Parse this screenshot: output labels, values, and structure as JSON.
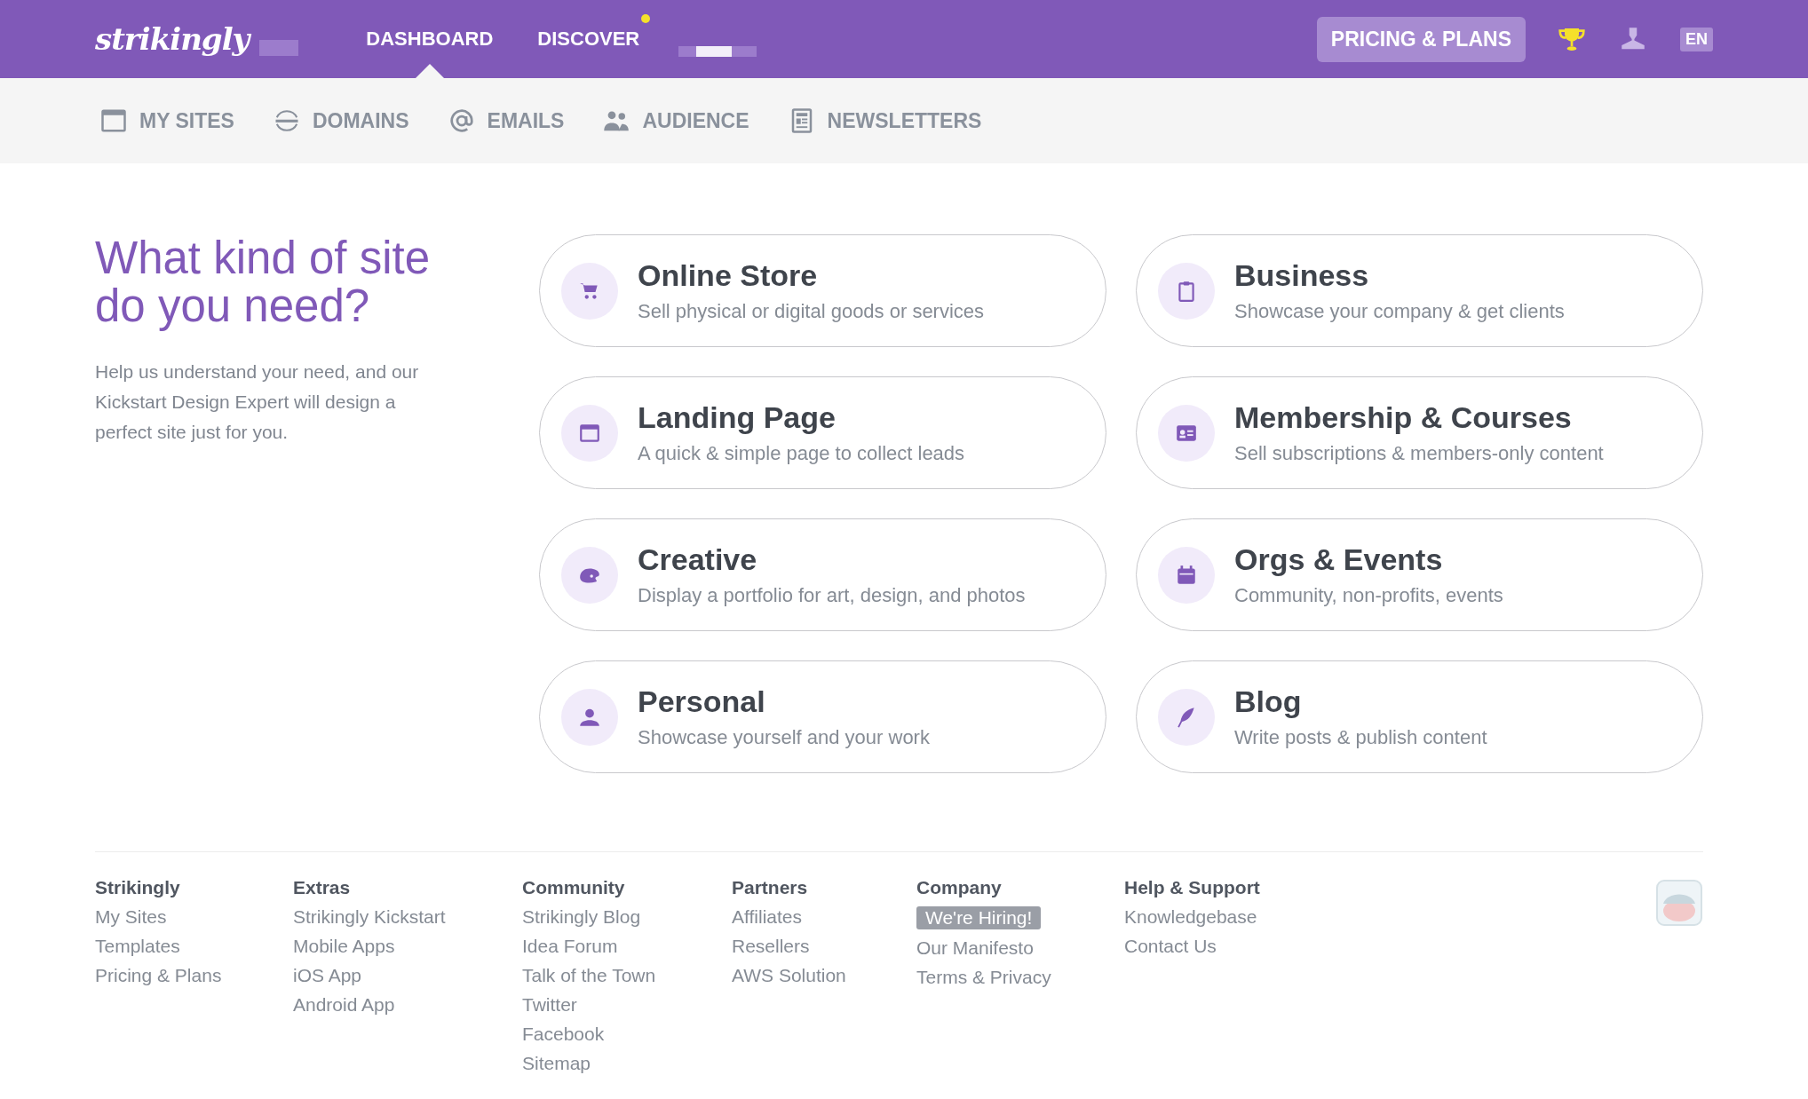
{
  "topbar": {
    "logo": "strikingly",
    "nav": [
      {
        "label": "DASHBOARD",
        "selected": true,
        "notification": false
      },
      {
        "label": "DISCOVER",
        "selected": false,
        "notification": true
      }
    ],
    "pricing_button": "PRICING & PLANS",
    "language": "EN"
  },
  "subnav": [
    {
      "label": "MY SITES"
    },
    {
      "label": "DOMAINS"
    },
    {
      "label": "EMAILS"
    },
    {
      "label": "AUDIENCE"
    },
    {
      "label": "NEWSLETTERS"
    }
  ],
  "intro": {
    "title": "What kind of site do you need?",
    "text": "Help us understand your need, and our Kickstart Design Expert will design a perfect site just for you."
  },
  "site_types": [
    {
      "title": "Online Store",
      "description": "Sell physical or digital goods or services"
    },
    {
      "title": "Business",
      "description": "Showcase your company & get clients"
    },
    {
      "title": "Landing Page",
      "description": "A quick & simple page to collect leads"
    },
    {
      "title": "Membership & Courses",
      "description": "Sell subscriptions & members-only content"
    },
    {
      "title": "Creative",
      "description": "Display a portfolio for art, design, and photos"
    },
    {
      "title": "Orgs & Events",
      "description": "Community, non-profits, events"
    },
    {
      "title": "Personal",
      "description": "Showcase yourself and your work"
    },
    {
      "title": "Blog",
      "description": "Write posts & publish content"
    }
  ],
  "footer": [
    {
      "heading": "Strikingly",
      "links": [
        {
          "label": "My Sites",
          "highlight": false
        },
        {
          "label": "Templates",
          "highlight": false
        },
        {
          "label": "Pricing & Plans",
          "highlight": false
        }
      ]
    },
    {
      "heading": "Extras",
      "links": [
        {
          "label": "Strikingly Kickstart",
          "highlight": false
        },
        {
          "label": "Mobile Apps",
          "highlight": false
        },
        {
          "label": "iOS App",
          "highlight": false
        },
        {
          "label": "Android App",
          "highlight": false
        }
      ]
    },
    {
      "heading": "Community",
      "links": [
        {
          "label": "Strikingly Blog",
          "highlight": false
        },
        {
          "label": "Idea Forum",
          "highlight": false
        },
        {
          "label": "Talk of the Town",
          "highlight": false
        },
        {
          "label": "Twitter",
          "highlight": false
        },
        {
          "label": "Facebook",
          "highlight": false
        },
        {
          "label": "Sitemap",
          "highlight": false
        }
      ]
    },
    {
      "heading": "Partners",
      "links": [
        {
          "label": "Affiliates",
          "highlight": false
        },
        {
          "label": "Resellers",
          "highlight": false
        },
        {
          "label": "AWS Solution",
          "highlight": false
        }
      ]
    },
    {
      "heading": "Company",
      "links": [
        {
          "label": "We're Hiring!",
          "highlight": true
        },
        {
          "label": "Our Manifesto",
          "highlight": false
        },
        {
          "label": "Terms & Privacy",
          "highlight": false
        }
      ]
    },
    {
      "heading": "Help & Support",
      "links": [
        {
          "label": "Knowledgebase",
          "highlight": false
        },
        {
          "label": "Contact Us",
          "highlight": false
        }
      ]
    }
  ]
}
